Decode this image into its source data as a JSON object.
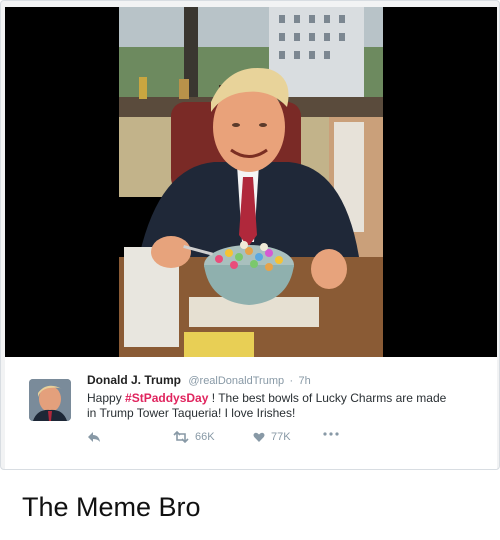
{
  "tweet": {
    "name": "Donald J. Trump",
    "handle": "@realDonaldTrump",
    "separator": "·",
    "time": "7h",
    "text_prefix": "Happy ",
    "hashtag": "#StPaddysDay",
    "text_line1_rest": " ! The best bowls of Lucky Charms are made",
    "text_line2": "in Trump Tower Taqueria! I love Irishes!",
    "retweets": "66K",
    "likes": "77K"
  },
  "caption": "The Meme Bro",
  "icons": [
    "reply-icon",
    "retweet-icon",
    "like-icon",
    "more-icon"
  ],
  "colors": {
    "hashtag": "#e0245e",
    "muted": "#8899a6",
    "text": "#292f33"
  }
}
